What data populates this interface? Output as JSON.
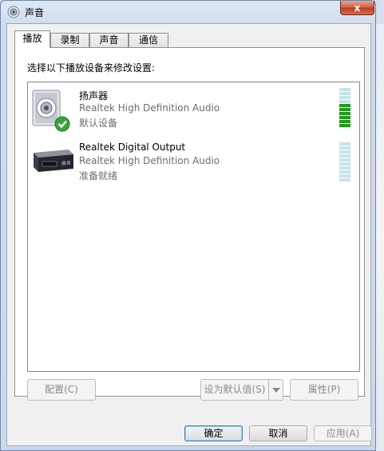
{
  "window": {
    "title": "声音",
    "close_glyph": "x"
  },
  "tabs": [
    {
      "label": "播放",
      "active": true
    },
    {
      "label": "录制",
      "active": false
    },
    {
      "label": "声音",
      "active": false
    },
    {
      "label": "通信",
      "active": false
    }
  ],
  "panel": {
    "instruction": "选择以下播放设备来修改设置:"
  },
  "devices": [
    {
      "name": "扬声器",
      "description": "Realtek High Definition Audio",
      "status": "默认设备",
      "icon": "speaker-icon",
      "default": true,
      "level": 0.55
    },
    {
      "name": "Realtek Digital Output",
      "description": "Realtek High Definition Audio",
      "status": "准备就绪",
      "icon": "digital-output-icon",
      "default": false,
      "level": 0
    }
  ],
  "buttons": {
    "configure": "配置(C)",
    "set_default": "设为默认值(S)",
    "properties": "属性(P)",
    "ok": "确定",
    "cancel": "取消",
    "apply": "应用(A)"
  },
  "colors": {
    "meter_active": "#1f9a1f",
    "meter_inactive": "#c6e3e8",
    "check": "#3aa53a"
  }
}
